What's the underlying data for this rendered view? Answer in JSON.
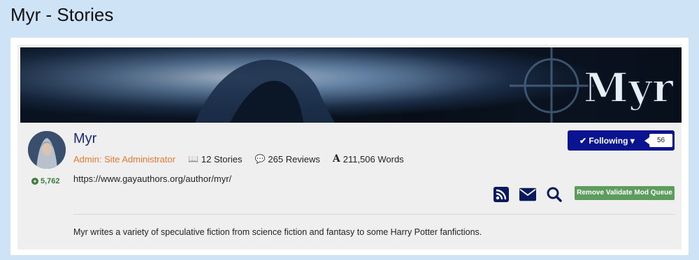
{
  "page": {
    "title": "Myr - Stories"
  },
  "banner": {
    "logo_text": "Myr"
  },
  "profile": {
    "name": "Myr",
    "role": "Admin: Site Administrator",
    "reputation": "5,762",
    "stories": "12 Stories",
    "reviews": "265 Reviews",
    "words": "211,506 Words",
    "url": "https://www.gayauthors.org/author/myr/",
    "bio": "Myr writes a variety of speculative fiction from science fiction and fantasy to some Harry Potter fanfictions."
  },
  "follow": {
    "label": "Following",
    "count": "56"
  },
  "actions": {
    "icons": [
      "rss-icon",
      "envelope-icon",
      "search-icon"
    ],
    "mod_label": "Remove Validate Mod Queue"
  },
  "colors": {
    "background": "#cfe3f7",
    "brand_navy": "#0a1490",
    "role_orange": "#e8772e",
    "rep_green": "#3c7a3c",
    "mod_green": "#5c9c5c"
  }
}
